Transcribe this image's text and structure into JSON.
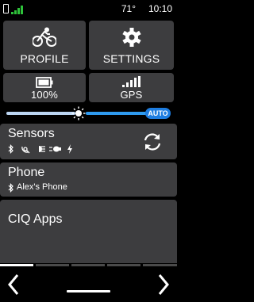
{
  "status": {
    "temperature": "71°",
    "time": "10:10",
    "battery_icon": "phone-icon",
    "signal_icon": "signal-bars-icon",
    "signal_color": "#2ec23a"
  },
  "tiles": {
    "profile": {
      "label": "PROFILE",
      "icon": "cyclist-icon"
    },
    "settings": {
      "label": "SETTINGS",
      "icon": "gear-icon"
    },
    "battery": {
      "label": "100%",
      "icon": "battery-icon"
    },
    "gps": {
      "label": "GPS",
      "icon": "gps-signal-icon"
    }
  },
  "brightness": {
    "auto_label": "AUTO",
    "level": 0.45,
    "accent_color": "#2f9bf0"
  },
  "sensors": {
    "title": "Sensors",
    "icons": [
      "bluetooth-icon",
      "radar-icon",
      "light-icon",
      "headlight-icon",
      "power-icon"
    ],
    "action_icon": "sync-icon"
  },
  "phone": {
    "title": "Phone",
    "device_name": "Alex's Phone"
  },
  "ciq": {
    "title": "CIQ Apps"
  },
  "pager": {
    "pages": 5,
    "active": 0
  }
}
